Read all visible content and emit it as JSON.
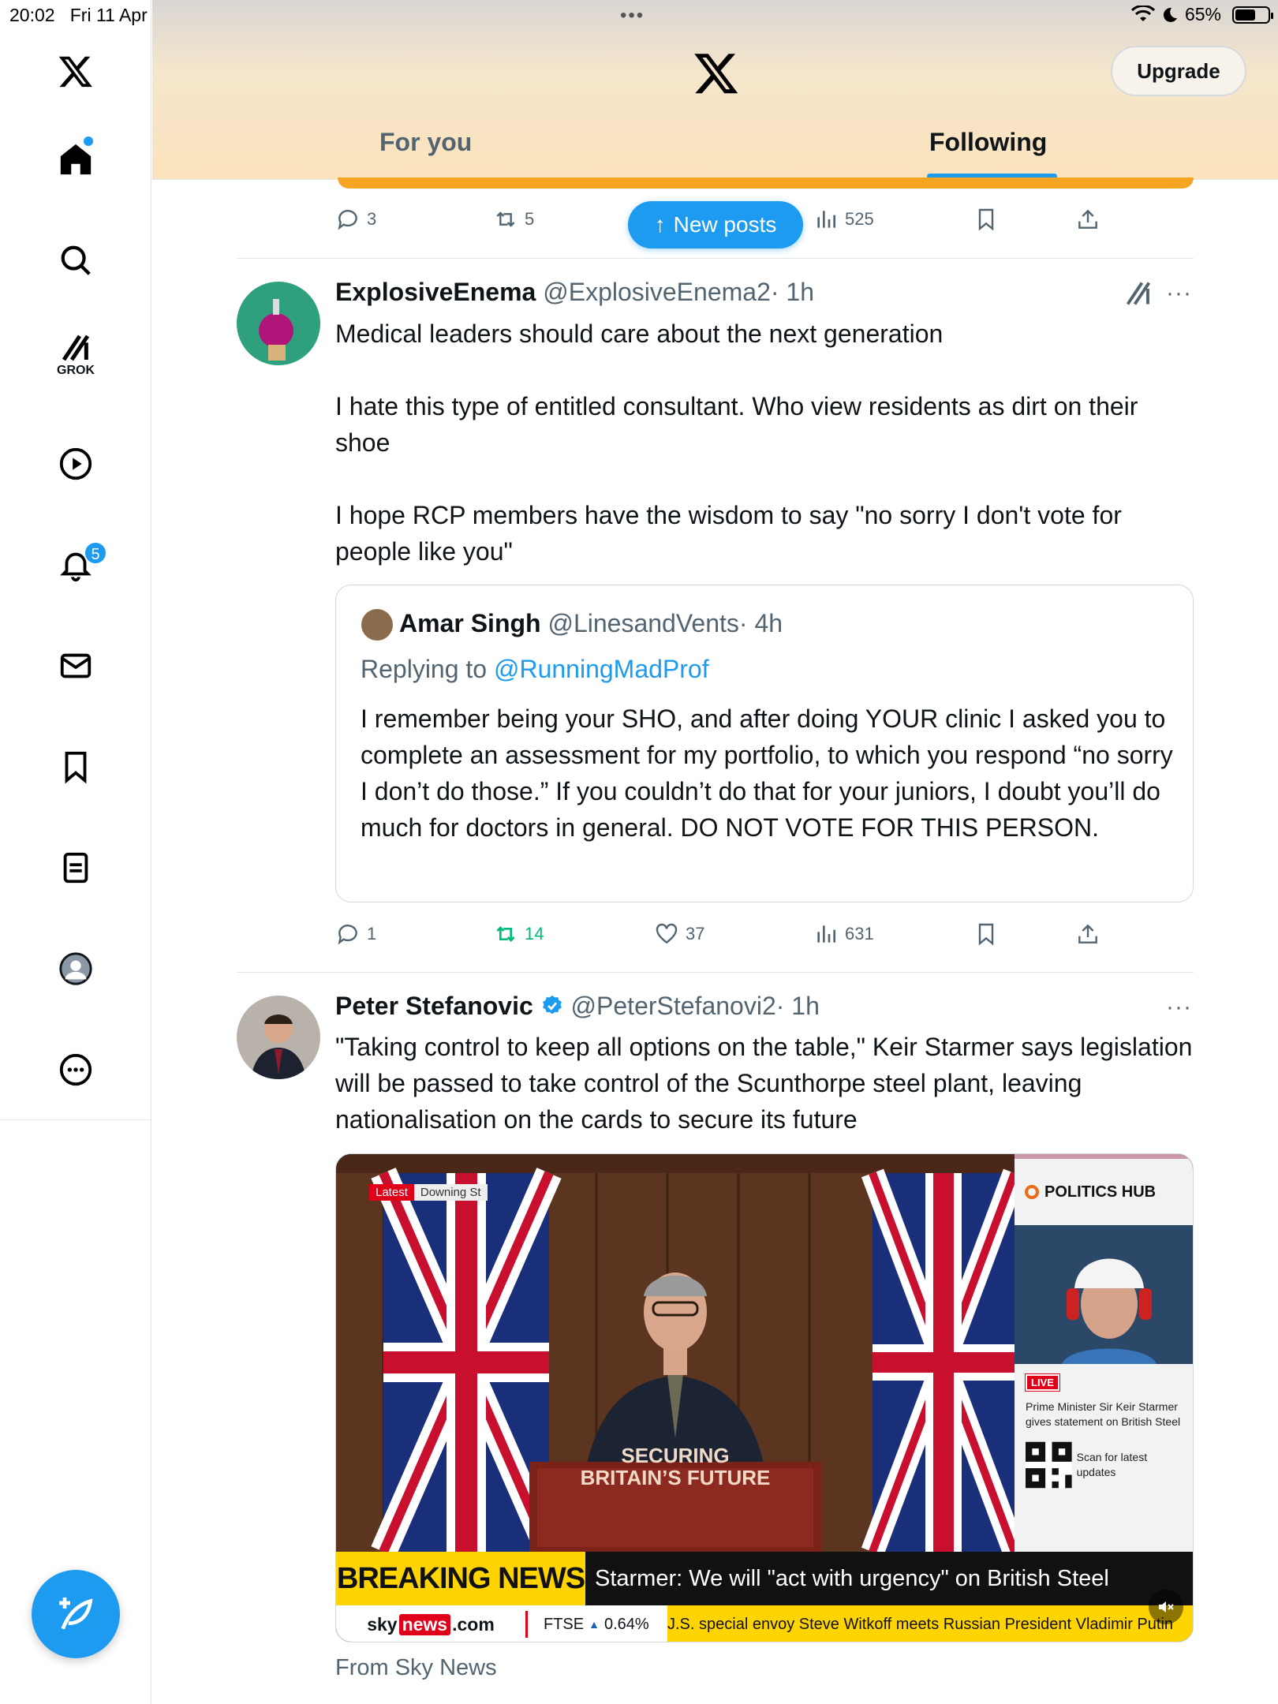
{
  "status": {
    "time": "20:02",
    "date": "Fri 11 Apr",
    "battery": "65%",
    "battery_level": 0.65
  },
  "sidebar": {
    "notifications_count": "5",
    "grok_label": "GROK"
  },
  "header": {
    "upgrade": "Upgrade",
    "tabs": [
      {
        "label": "For you"
      },
      {
        "label": "Following"
      }
    ],
    "new_posts": "New posts"
  },
  "prev_post": {
    "replies": "3",
    "reposts": "5",
    "views": "525"
  },
  "posts": [
    {
      "name": "ExplosiveEnema",
      "handle": "@ExplosiveEnema2",
      "time": "· 1h",
      "paragraphs": [
        "Medical leaders should care about the next generation",
        "I hate this type of entitled consultant. Who view residents as dirt on their shoe",
        "I hope RCP members have the wisdom to say \"no sorry I don't vote for people like you\""
      ],
      "quote": {
        "name": "Amar Singh",
        "handle": "@LinesandVents",
        "time": "· 4h",
        "replying_prefix": "Replying to ",
        "replying_to": "@RunningMadProf",
        "text": "I remember being your SHO, and after doing YOUR clinic I asked you to complete an assessment for my portfolio, to which you respond “no sorry I don’t do those.” If you couldn’t do that for your juniors, I doubt you’ll do much for doctors in general. DO NOT VOTE FOR THIS PERSON."
      },
      "replies": "1",
      "reposts": "14",
      "likes": "37",
      "views": "631"
    },
    {
      "name": "Peter Stefanovic",
      "handle": "@PeterStefanovi2",
      "time": "· 1h",
      "text": "\"Taking control to keep all options on the table,\" Keir Starmer says legislation will be passed to take control of the Scunthorpe steel plant, leaving nationalisation on the cards to secure its future",
      "media": {
        "tag_latest": "Latest",
        "tag_location": "Downing St",
        "politics_hub": "POLITICS HUB",
        "live": "LIVE",
        "live_text": "Prime Minister Sir Keir Starmer gives statement on British Steel",
        "qr_text": "Scan for latest updates",
        "lectern_line1": "SECURING",
        "lectern_line2": "BRITAIN’S FUTURE",
        "breaking": "BREAKING NEWS",
        "headline": "Starmer: We will \"act with urgency\" on British Steel",
        "sky": "sky",
        "news": "news",
        "dotcom": ".com",
        "ftse": "FTSE",
        "ftse_change": "0.64%",
        "ticker": "J.S. special envoy Steve Witkoff meets Russian President Vladimir Putin"
      },
      "from": "From Sky News"
    }
  ]
}
